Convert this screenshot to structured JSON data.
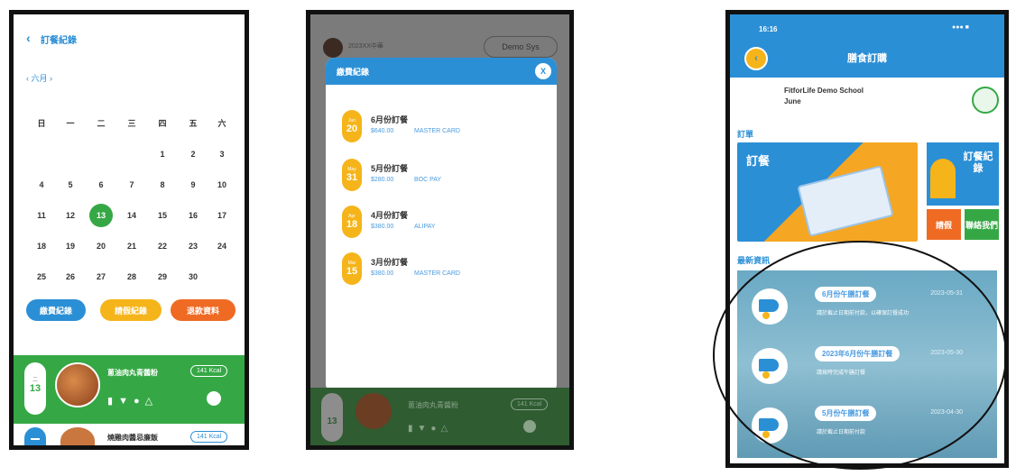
{
  "phone1": {
    "title": "訂餐紀錄",
    "month": "六月",
    "weekdays": [
      "日",
      "一",
      "二",
      "三",
      "四",
      "五",
      "六"
    ],
    "weeks": [
      [
        "",
        "",
        "",
        "",
        "1",
        "2",
        "3"
      ],
      [
        "4",
        "5",
        "6",
        "7",
        "8",
        "9",
        "10"
      ],
      [
        "11",
        "12",
        "13",
        "14",
        "15",
        "16",
        "17"
      ],
      [
        "18",
        "19",
        "20",
        "21",
        "22",
        "23",
        "24"
      ],
      [
        "25",
        "26",
        "27",
        "28",
        "29",
        "30",
        ""
      ]
    ],
    "selected_day": "13",
    "buttons": [
      "繳費紀錄",
      "請假紀錄",
      "退款資料"
    ],
    "meal": {
      "day_label": "二",
      "day": "13",
      "name": "蔥油肉丸青醬粉",
      "kcal": "141 Kcal"
    },
    "meal2": {
      "name": "燒雞肉醬忌廉飯",
      "kcal": "141 Kcal"
    },
    "colors": {
      "blue": "#2b8fd6",
      "yellow": "#f5b41a",
      "orange": "#ef6a23",
      "green": "#35a845"
    }
  },
  "phone2": {
    "header_name": "2023XX中華",
    "header_btn": "Demo Sys",
    "modal_title": "繳費紀錄",
    "close": "X",
    "records": [
      {
        "month": "Jun",
        "day": "20",
        "title": "6月份訂餐",
        "amount": "$640.00",
        "method": "MASTER CARD"
      },
      {
        "month": "May",
        "day": "31",
        "title": "5月份訂餐",
        "amount": "$280.00",
        "method": "BOC PAY"
      },
      {
        "month": "Apr",
        "day": "18",
        "title": "4月份訂餐",
        "amount": "$380.00",
        "method": "ALIPAY"
      },
      {
        "month": "Mar",
        "day": "15",
        "title": "3月份訂餐",
        "amount": "$380.00",
        "method": "MASTER CARD"
      }
    ],
    "meal": {
      "day": "13",
      "name": "蔥油肉丸青醬粉",
      "kcal": "141 Kcal"
    }
  },
  "phone3": {
    "time": "16:16",
    "title": "膳食訂購",
    "school": "FitforLife Demo School",
    "student": "June",
    "section_order": "訂單",
    "order_label": "訂餐",
    "record_label": "訂餐紀錄",
    "btn_leave": "請假",
    "btn_contact": "聯絡我們",
    "section_news": "最新資訊",
    "news": [
      {
        "title": "6月份午膳訂餐",
        "date": "2023-05-31",
        "sub": "請於截止日期前付款，以確保訂餐成功"
      },
      {
        "title": "2023年6月份午膳訂餐",
        "date": "2023-05-30",
        "sub": "請按時完成午膳訂餐"
      },
      {
        "title": "5月份午膳訂餐",
        "date": "2023-04-30",
        "sub": "請於截止日期前付款"
      }
    ]
  }
}
